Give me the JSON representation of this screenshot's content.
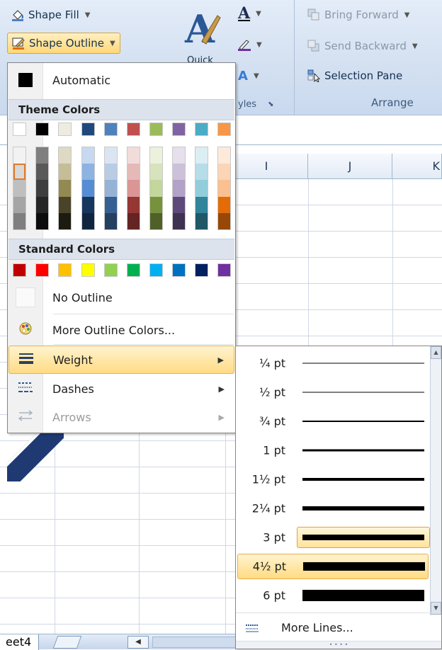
{
  "ribbon": {
    "shape_fill": "Shape Fill",
    "shape_outline": "Shape Outline",
    "quick_styles_frag": "Quick",
    "styles_group_frag": "yles",
    "bring_forward": "Bring Forward",
    "send_backward": "Send Backward",
    "selection_pane": "Selection Pane",
    "arrange_group": "Arrange"
  },
  "grid": {
    "columns": [
      "I",
      "J",
      "K"
    ]
  },
  "sheet_tab": "eet4",
  "outline_menu": {
    "automatic": "Automatic",
    "theme_colors_header": "Theme Colors",
    "standard_colors_header": "Standard Colors",
    "no_outline": "No Outline",
    "more_colors": "More Outline Colors...",
    "weight": "Weight",
    "dashes": "Dashes",
    "arrows": "Arrows"
  },
  "theme_colors": {
    "top": [
      "#ffffff",
      "#000000",
      "#eeece1",
      "#1f497d",
      "#4f81bd",
      "#c0504d",
      "#9bbb59",
      "#8064a2",
      "#4bacc6",
      "#f79646"
    ],
    "shades": [
      [
        "#f2f2f2",
        "#d8d8d8",
        "#bfbfbf",
        "#a5a5a5",
        "#7f7f7f"
      ],
      [
        "#7f7f7f",
        "#595959",
        "#3f3f3f",
        "#262626",
        "#0c0c0c"
      ],
      [
        "#ddd9c3",
        "#c4bd97",
        "#938953",
        "#494429",
        "#1d1b10"
      ],
      [
        "#c6d9f0",
        "#8db3e2",
        "#548dd4",
        "#17365d",
        "#0f243e"
      ],
      [
        "#dbe5f1",
        "#b8cce4",
        "#95b3d7",
        "#366092",
        "#244061"
      ],
      [
        "#f2dcdb",
        "#e5b9b7",
        "#d99694",
        "#953734",
        "#632423"
      ],
      [
        "#ebf1dd",
        "#d7e3bc",
        "#c3d69b",
        "#76923c",
        "#4f6128"
      ],
      [
        "#e5e0ec",
        "#ccc1d9",
        "#b2a2c7",
        "#5f497a",
        "#3f3151"
      ],
      [
        "#dbeef3",
        "#b7dde8",
        "#92cddc",
        "#31859b",
        "#205867"
      ],
      [
        "#fdeada",
        "#fbd5b5",
        "#fac08f",
        "#e36c09",
        "#974806"
      ]
    ]
  },
  "standard_colors": [
    "#c00000",
    "#ff0000",
    "#ffc000",
    "#ffff00",
    "#92d050",
    "#00b050",
    "#00b0f0",
    "#0070c0",
    "#002060",
    "#7030a0"
  ],
  "weight_menu": {
    "options": [
      {
        "label": "¼ pt",
        "thickness": 0.25
      },
      {
        "label": "½ pt",
        "thickness": 0.5
      },
      {
        "label": "¾ pt",
        "thickness": 0.75
      },
      {
        "label": "1 pt",
        "thickness": 1
      },
      {
        "label": "1½ pt",
        "thickness": 1.5
      },
      {
        "label": "2¼ pt",
        "thickness": 2.25
      },
      {
        "label": "3 pt",
        "thickness": 3
      },
      {
        "label": "4½ pt",
        "thickness": 4.5
      },
      {
        "label": "6 pt",
        "thickness": 6
      }
    ],
    "selected": "3 pt",
    "hovered": "4½ pt",
    "more_lines": "More Lines..."
  }
}
